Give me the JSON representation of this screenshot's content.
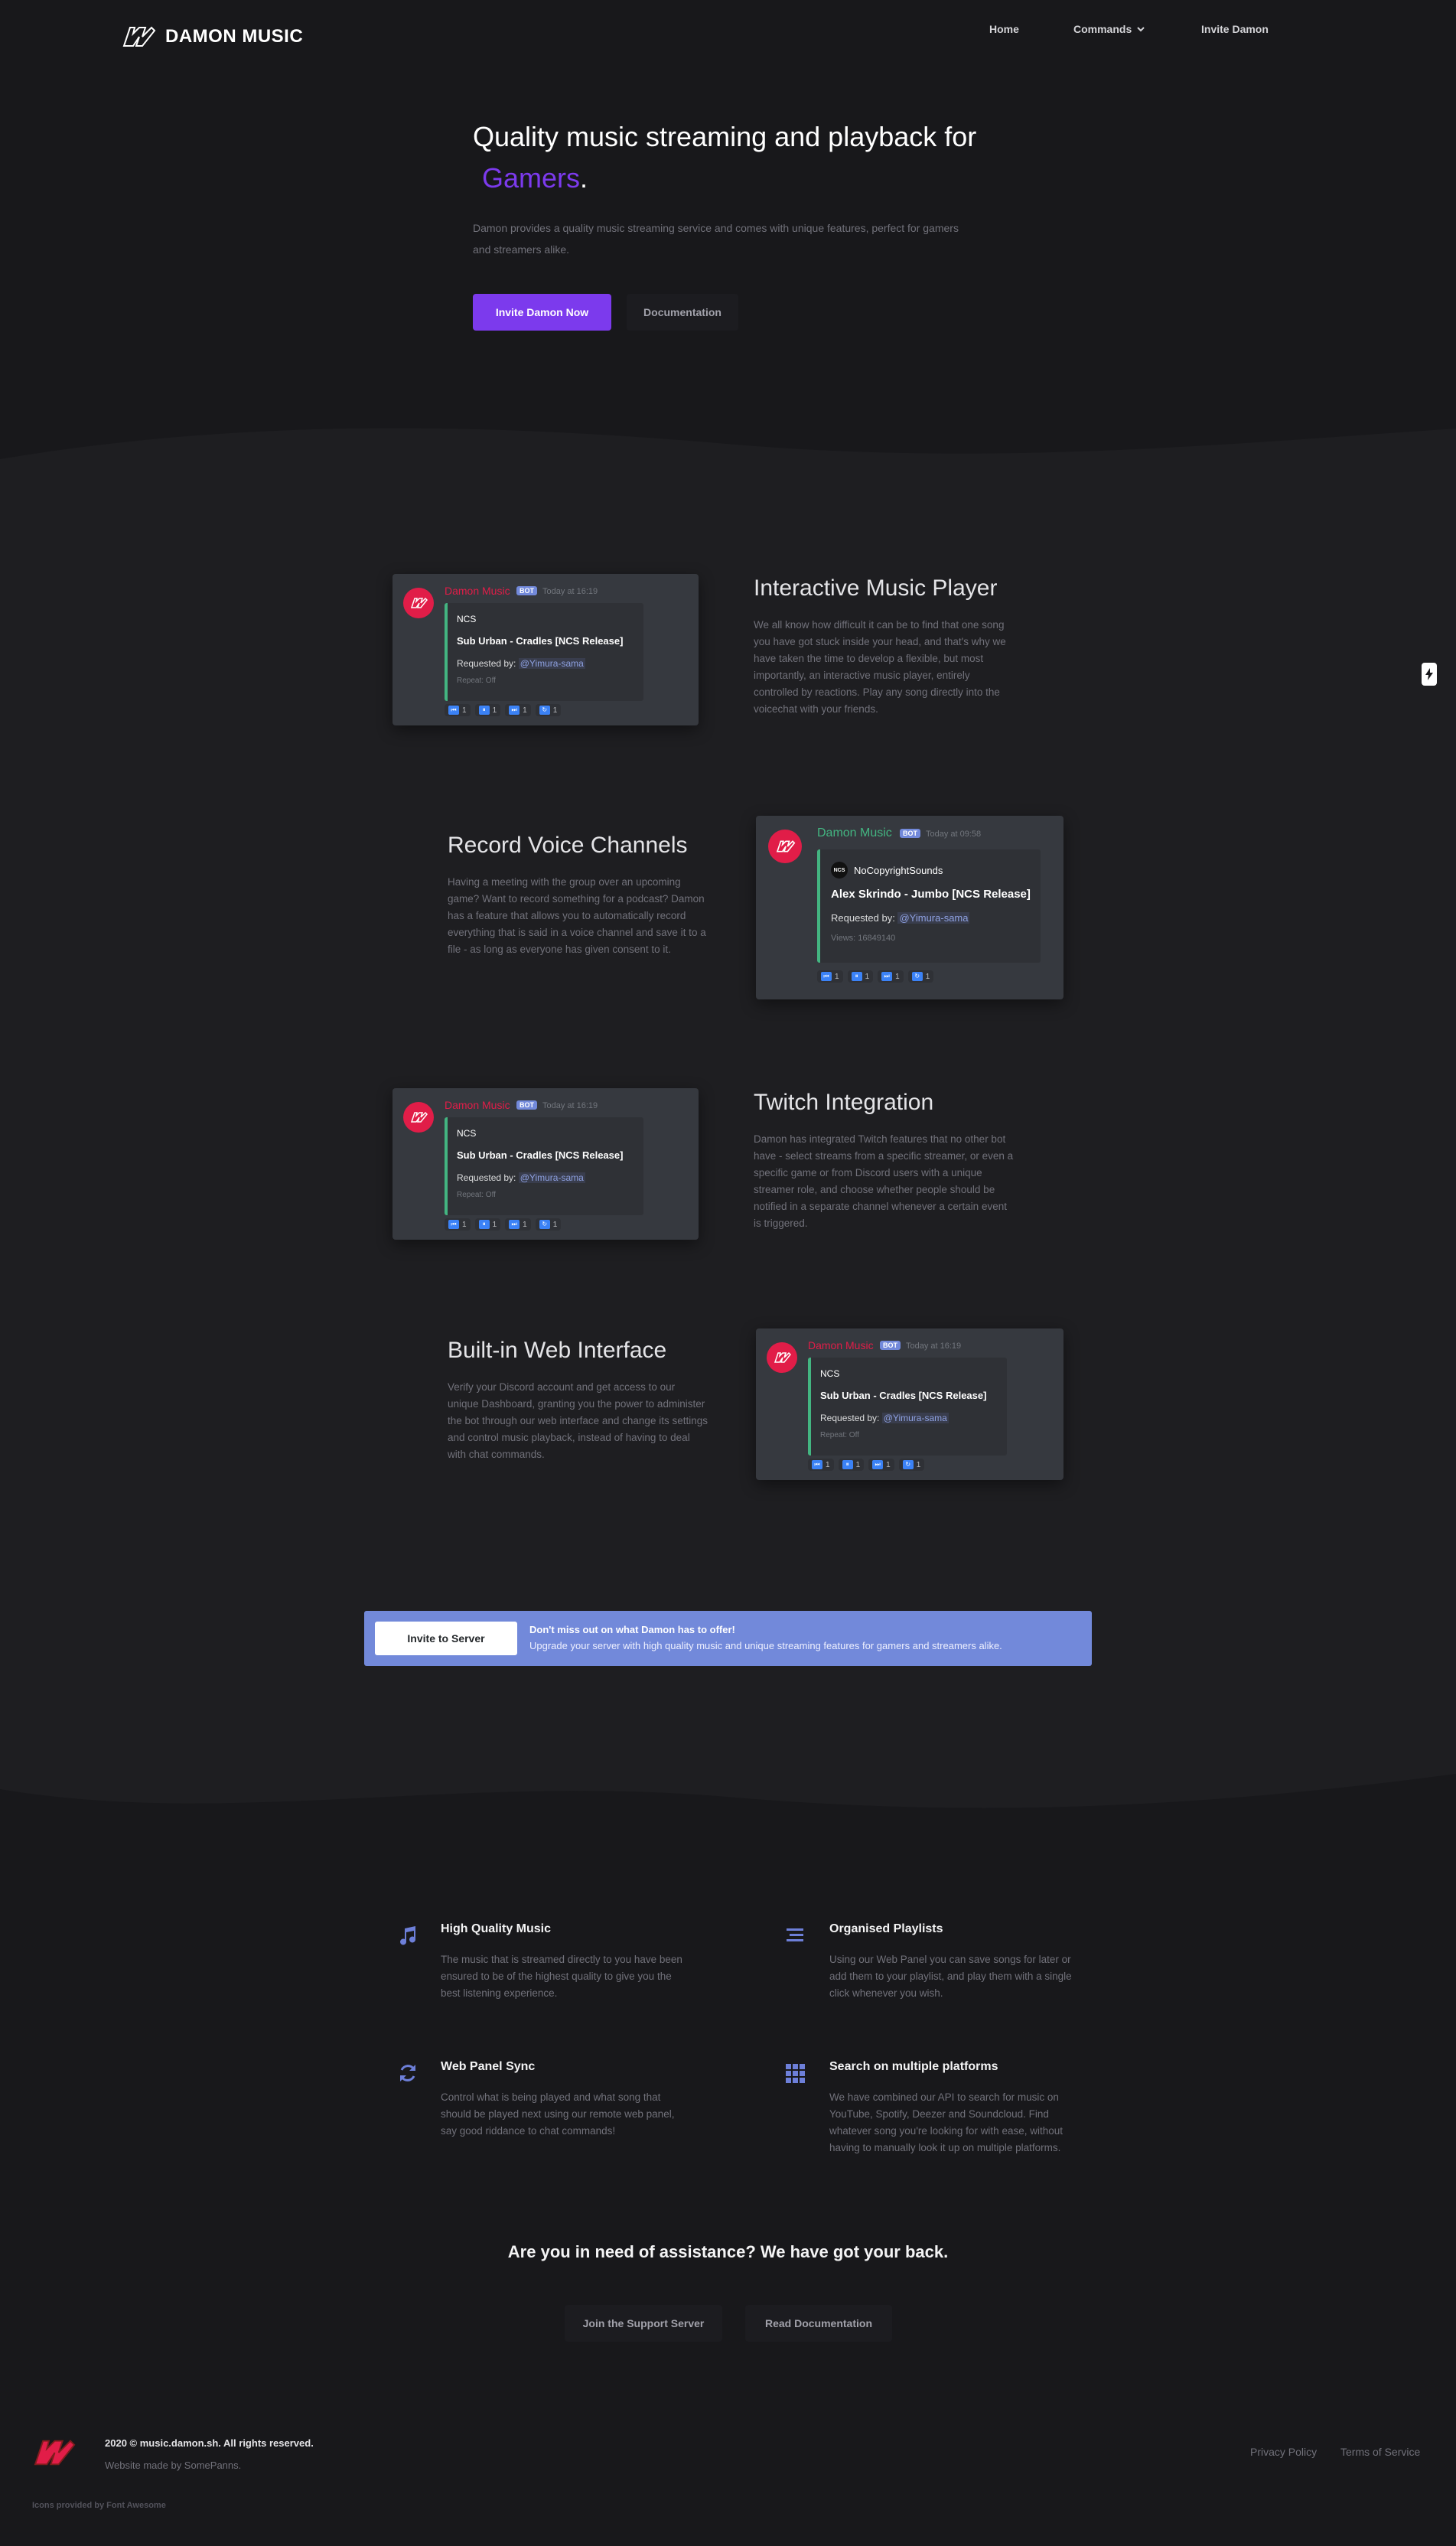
{
  "header": {
    "brand": "DAMON MUSIC",
    "nav": {
      "home": "Home",
      "commands": "Commands",
      "invite": "Invite Damon"
    }
  },
  "hero": {
    "title_line1": "Quality music streaming and playback for",
    "title_accent": "Gamers",
    "title_end": ".",
    "desc_line1": "Damon provides a quality music streaming service and comes with unique features, perfect for gamers",
    "desc_line2": "and streamers alike.",
    "primary_button": "Invite Damon Now",
    "secondary_button": "Documentation"
  },
  "features": [
    {
      "title": "Interactive Music Player",
      "desc": "We all know how difficult it can be to find that one song you have got stuck inside your head, and that's why we have taken the time to develop a flexible, but most importantly, an interactive music player, entirely controlled by reactions. Play any song directly into the voicechat with your friends."
    },
    {
      "title": "Record Voice Channels",
      "desc": "Having a meeting with the group over an upcoming game? Want to record something for a podcast? Damon has a feature that allows you to automatically record everything that is said in a voice channel and save it to a file - as long as everyone has given consent to it."
    },
    {
      "title": "Twitch Integration",
      "desc": "Damon has integrated Twitch features that no other bot have - select streams from a specific streamer, or even a specific game or from Discord users with a unique streamer role, and choose whether people should be notified in a separate channel whenever a certain event is triggered."
    },
    {
      "title": "Built-in Web Interface",
      "desc": "Verify your Discord account and get access to our unique Dashboard, granting you the power to administer the bot through our web interface and change its settings and control music playback, instead of having to deal with chat commands."
    }
  ],
  "embeds": {
    "ncs": {
      "bot_name": "Damon Music",
      "bot_tag": "BOT",
      "time": "Today at 16:19",
      "author": "NCS",
      "track": "Sub Urban - Cradles [NCS Release]",
      "requested_label": "Requested by:",
      "requester": "@Yimura-sama",
      "footer": "Repeat: Off",
      "reactions": [
        "1",
        "1",
        "1",
        "1"
      ]
    },
    "nocopyright": {
      "bot_name": "Damon Music",
      "bot_tag": "BOT",
      "time": "Today at 09:58",
      "author": "NoCopyrightSounds",
      "track": "Alex Skrindo - Jumbo [NCS Release]",
      "requested_label": "Requested by:",
      "requester": "@Yimura-sama",
      "footer": "Views: 16849140",
      "reactions": [
        "1",
        "1",
        "1",
        "1"
      ]
    }
  },
  "banner": {
    "button": "Invite to Server",
    "title": "Don't miss out on what Damon has to offer!",
    "subtitle": "Upgrade your server with high quality music and unique streaming features for gamers and streamers alike."
  },
  "small_features": [
    {
      "icon": "music-note-icon",
      "title": "High Quality Music",
      "desc": "The music that is streamed directly to you have been ensured to be of the highest quality to give you the best listening experience."
    },
    {
      "icon": "list-icon",
      "title": "Organised Playlists",
      "desc": "Using our Web Panel you can save songs for later or add them to your playlist, and play them with a single click whenever you wish."
    },
    {
      "icon": "sync-icon",
      "title": "Web Panel Sync",
      "desc": "Control what is being played and what song that should be played next using our remote web panel, say good riddance to chat commands!"
    },
    {
      "icon": "grid-icon",
      "title": "Search on multiple platforms",
      "desc": "We have combined our API to search for music on YouTube, Spotify, Deezer and Soundcloud. Find whatever song you're looking for with ease, without having to manually look it up on multiple platforms."
    }
  ],
  "assist": {
    "title": "Are you in need of assistance? We have got your back.",
    "support_button": "Join the Support Server",
    "docs_button": "Read Documentation"
  },
  "footer": {
    "copyright": "2020 © music.damon.sh. All rights reserved.",
    "made_by": "Website made by SomePanns.",
    "icons_credit": "Icons provided by Font Awesome",
    "privacy": "Privacy Policy",
    "terms": "Terms of Service"
  },
  "colors": {
    "accent": "#7c3aed",
    "background": "#18181b",
    "banner": "#7289da",
    "icon_blue": "#6d7fd9"
  }
}
